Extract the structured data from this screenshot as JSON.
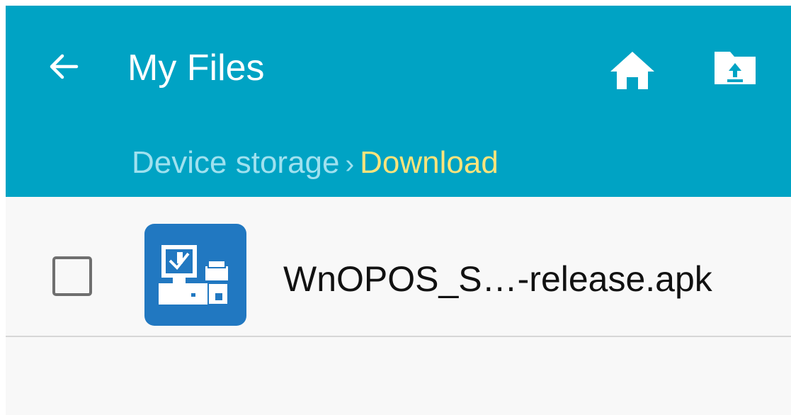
{
  "header": {
    "title": "My Files",
    "back_icon": "arrow-left-icon",
    "home_icon": "home-icon",
    "upload_icon": "folder-up-icon",
    "background_color": "#00a3c4"
  },
  "breadcrumb": {
    "root": "Device storage",
    "separator": "›",
    "current": "Download",
    "root_color": "#9fe1ef",
    "current_color": "#fde47b"
  },
  "files": [
    {
      "name": "WnOPOS_S…-release.apk",
      "icon": "pos-terminal-app-icon",
      "checked": false
    }
  ]
}
